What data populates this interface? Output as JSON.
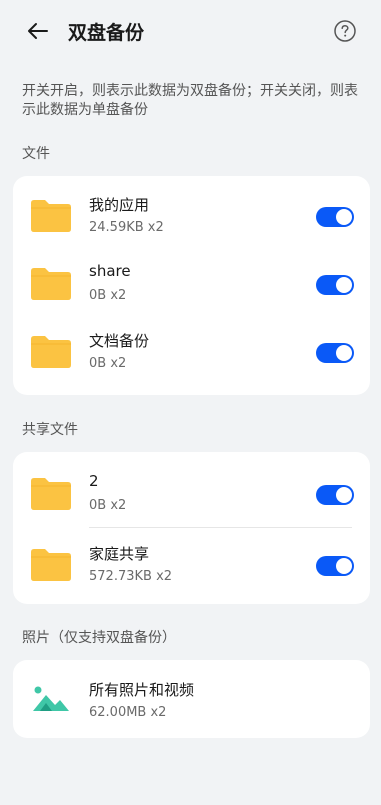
{
  "header": {
    "title": "双盘备份",
    "back_icon": "arrow-left-icon",
    "help_icon": "question-circle-icon"
  },
  "description": "开关开启，则表示此数据为双盘备份；开关关闭，则表示此数据为单盘备份",
  "sections": {
    "files": {
      "title": "文件",
      "items": [
        {
          "name": "我的应用",
          "size": "24.59KB x2",
          "enabled": true
        },
        {
          "name": "share",
          "size": "0B x2",
          "enabled": true
        },
        {
          "name": "文档备份",
          "size": "0B x2",
          "enabled": true
        }
      ]
    },
    "shared": {
      "title": "共享文件",
      "items": [
        {
          "name": "2",
          "size": "0B x2",
          "enabled": true
        },
        {
          "name": "家庭共享",
          "size": "572.73KB x2",
          "enabled": true
        }
      ]
    },
    "photos": {
      "title": "照片（仅支持双盘备份）",
      "items": [
        {
          "name": "所有照片和视频",
          "size": "62.00MB x2"
        }
      ]
    }
  },
  "colors": {
    "toggle_on": "#0a59f7",
    "folder": "#fbc342",
    "photo_icon": "#3fc7a7"
  }
}
